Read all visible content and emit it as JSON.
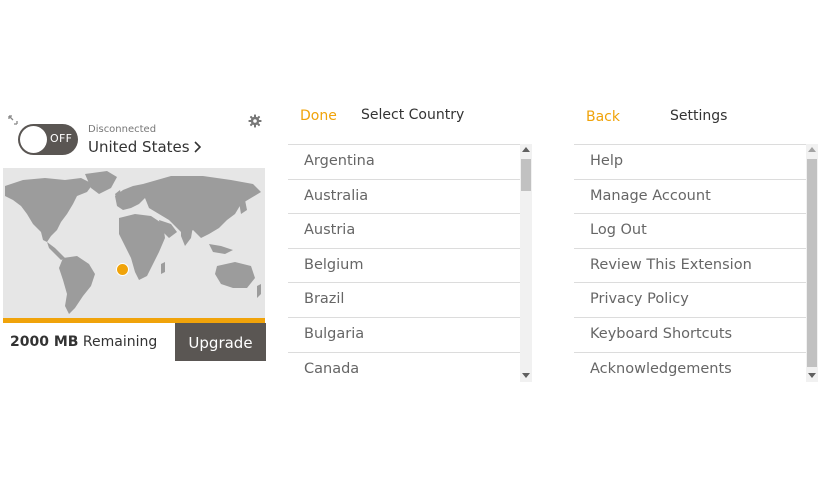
{
  "main_panel": {
    "toggle_label": "OFF",
    "status": "Disconnected",
    "location": "United States",
    "remaining_amount": "2000 MB",
    "remaining_label": "Remaining",
    "upgrade_label": "Upgrade",
    "icons": {
      "corner": "expand-icon",
      "settings": "gear-icon",
      "location_chevron": "chevron-right-icon",
      "map": "world-map"
    }
  },
  "country_panel": {
    "done_label": "Done",
    "title": "Select Country",
    "countries": [
      "Argentina",
      "Australia",
      "Austria",
      "Belgium",
      "Brazil",
      "Bulgaria",
      "Canada"
    ]
  },
  "settings_panel": {
    "back_label": "Back",
    "title": "Settings",
    "items": [
      "Help",
      "Manage Account",
      "Log Out",
      "Review This Extension",
      "Privacy Policy",
      "Keyboard Shortcuts",
      "Acknowledgements"
    ]
  },
  "colors": {
    "accent": "#f0a30a",
    "dark": "#5a5653",
    "map_land": "#9c9c9c",
    "map_bg": "#e6e6e6"
  }
}
